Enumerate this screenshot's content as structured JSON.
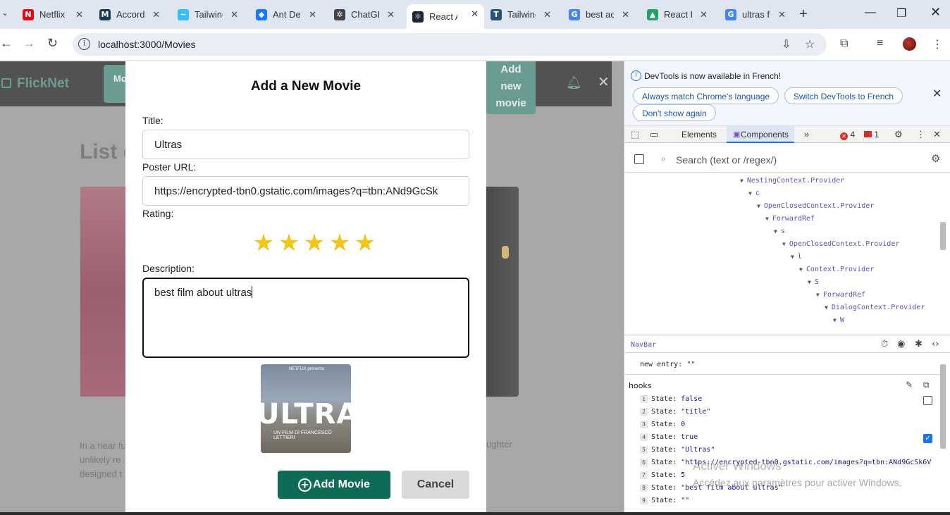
{
  "browser": {
    "tabs": [
      {
        "title": "Netflix",
        "icon": "netflix-icon",
        "color": "#e50914",
        "glyph": "N"
      },
      {
        "title": "Accordi",
        "icon": "docs-icon",
        "color": "#1b3a57",
        "glyph": "M"
      },
      {
        "title": "Tailwinc",
        "icon": "tailwind-icon",
        "color": "#38bdf8",
        "glyph": "~"
      },
      {
        "title": "Ant Des",
        "icon": "antdesign-icon",
        "color": "#1677ff",
        "glyph": "◆"
      },
      {
        "title": "ChatGP",
        "icon": "chatgpt-icon",
        "color": "#444444",
        "glyph": "✲"
      },
      {
        "title": "React A",
        "icon": "react-icon",
        "color": "#1b2630",
        "glyph": "⚛"
      },
      {
        "title": "Tailwinc",
        "icon": "tailwind-elements-icon",
        "color": "#2c4f7a",
        "glyph": "T"
      },
      {
        "title": "best ac",
        "icon": "google-icon",
        "color": "#4285f4",
        "glyph": "G"
      },
      {
        "title": "React H",
        "icon": "google-drive-icon",
        "color": "#1fa463",
        "glyph": "▲"
      },
      {
        "title": "ultras fi",
        "icon": "google-icon",
        "color": "#4285f4",
        "glyph": "G"
      }
    ],
    "url": "localhost:3000/Movies"
  },
  "page": {
    "brand": "FlickNet",
    "nav_pill": "Mo",
    "add_movie_nav": [
      "Add",
      "new",
      "movie"
    ],
    "list_heading": "List o",
    "bg_text_lines": [
      "In a near fu",
      "unlikely re",
      "designed t"
    ],
    "bg_text_right": "ughter"
  },
  "modal": {
    "title": "Add a New Movie",
    "title_label": "Title:",
    "title_value": "Ultras",
    "poster_label": "Poster URL:",
    "poster_value": "https://encrypted-tbn0.gstatic.com/images?q=tbn:ANd9GcSk",
    "rating_label": "Rating:",
    "rating": 5,
    "rating_max": 5,
    "description_label": "Description:",
    "description_value": "best film about ultras",
    "preview": {
      "top": "NETFLIX presenta",
      "title": "ULTRAS",
      "sub": "UN FILM DI FRANCESCO LETTIERI"
    },
    "add_button": "Add Movie",
    "cancel_button": "Cancel"
  },
  "devtools": {
    "info_message": "DevTools is now available in French!",
    "btn_match": "Always match Chrome's language",
    "btn_switch": "Switch DevTools to French",
    "btn_dont": "Don't show again",
    "tab_elements": "Elements",
    "tab_components": "Components",
    "errors": "4",
    "issues": "1",
    "search_placeholder": "Search (text or /regex/)",
    "tree": [
      {
        "label": "NestingContext.Provider",
        "depth": 0
      },
      {
        "label": "c",
        "depth": 1
      },
      {
        "label": "OpenClosedContext.Provider",
        "depth": 2
      },
      {
        "label": "ForwardRef",
        "depth": 3
      },
      {
        "label": "s",
        "depth": 4
      },
      {
        "label": "OpenClosedContext.Provider",
        "depth": 5
      },
      {
        "label": "l",
        "depth": 6
      },
      {
        "label": "Context.Provider",
        "depth": 7
      },
      {
        "label": "S",
        "depth": 8
      },
      {
        "label": "ForwardRef",
        "depth": 9
      },
      {
        "label": "DialogContext.Provider",
        "depth": 10
      },
      {
        "label": "W",
        "depth": 11
      }
    ],
    "selected_component": "NavBar",
    "prop_row": "new entry: \"\"",
    "hooks_title": "hooks",
    "hooks": [
      {
        "n": "1",
        "value": "false"
      },
      {
        "n": "2",
        "value": "\"title\""
      },
      {
        "n": "3",
        "value": "0"
      },
      {
        "n": "4",
        "value": "true"
      },
      {
        "n": "5",
        "value": "\"Ultras\""
      },
      {
        "n": "6",
        "value": "\"https://encrypted-tbn0.gstatic.com/images?q=tbn:ANd9GcSk6V"
      },
      {
        "n": "7",
        "value": "5"
      },
      {
        "n": "8",
        "value": "\"best film about ultras\""
      },
      {
        "n": "9",
        "value": "\"\""
      }
    ],
    "hook_state_label": "State:",
    "watermark_title": "Activer Windows",
    "watermark_sub": "Accédez aux paramètres pour activer Windows."
  }
}
